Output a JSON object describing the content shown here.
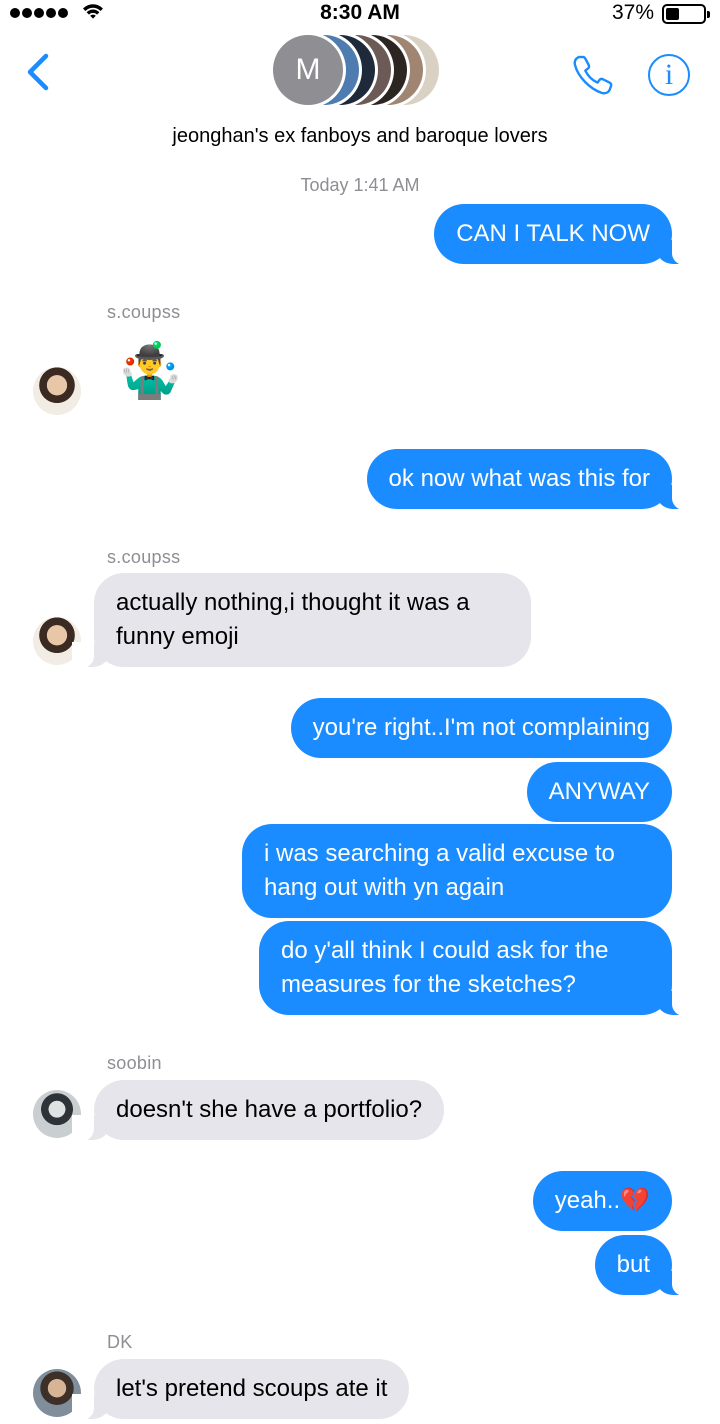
{
  "status_bar": {
    "time": "8:30 AM",
    "battery": "37%",
    "battery_level": 0.37
  },
  "header": {
    "avatar_initial": "M",
    "group_name": "jeonghan's ex fanboys and baroque lovers",
    "colors": {
      "accent": "#1a8cff"
    }
  },
  "conversation": {
    "timestamp": "Today 1:41 AM",
    "messages": [
      {
        "dir": "out",
        "text": "CAN I TALK NOW"
      },
      {
        "dir": "in",
        "sender": "s.coupss",
        "text": "🤹‍♂️"
      },
      {
        "dir": "out",
        "text": "ok now what was this for"
      },
      {
        "dir": "in",
        "sender": "s.coupss",
        "text": "actually nothing,i thought it was a funny emoji"
      },
      {
        "dir": "out",
        "text": "you're right..I'm not complaining"
      },
      {
        "dir": "out",
        "text": "ANYWAY"
      },
      {
        "dir": "out",
        "text": "i was searching a valid excuse to hang out with yn again"
      },
      {
        "dir": "out",
        "text": "do y'all think I could ask for the measures for the sketches?"
      },
      {
        "dir": "in",
        "sender": "soobin",
        "text": "doesn't she have a portfolio?"
      },
      {
        "dir": "out",
        "text": "yeah..💔"
      },
      {
        "dir": "out",
        "text": "but"
      },
      {
        "dir": "in",
        "sender": "DK",
        "text": "let's pretend scoups ate it"
      }
    ]
  },
  "bubble_colors": {
    "outgoing": "#1a8cff",
    "incoming": "#e6e5eb"
  }
}
